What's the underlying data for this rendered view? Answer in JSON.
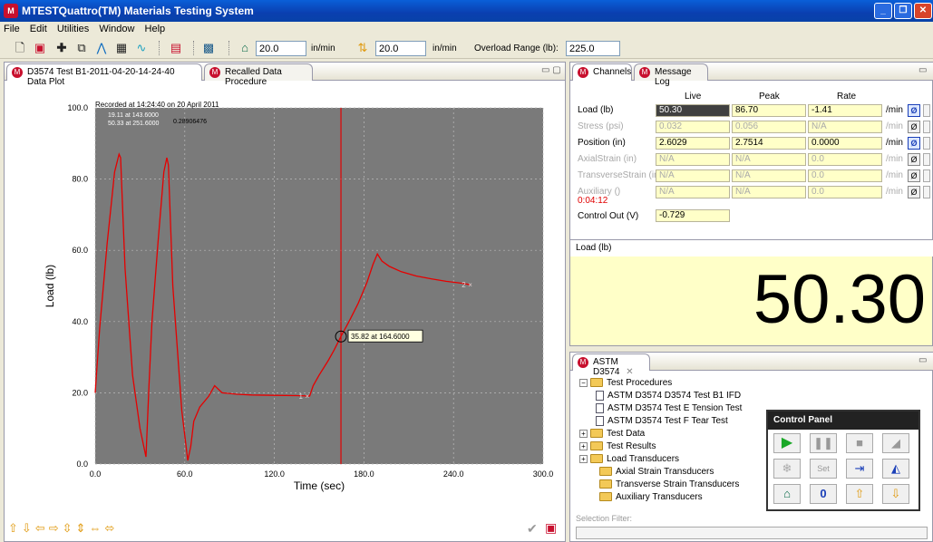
{
  "window": {
    "title": "MTESTQuattro(TM) Materials Testing System",
    "app_icon": "M"
  },
  "menu": [
    "File",
    "Edit",
    "Utilities",
    "Window",
    "Help"
  ],
  "toolbar": {
    "speed1_value": "20.0",
    "speed1_unit": "in/min",
    "speed2_value": "20.0",
    "speed2_unit": "in/min",
    "overload_label": "Overload Range (lb):",
    "overload_value": "225.0"
  },
  "left_tabs": [
    {
      "label": "D3574 Test B1-2011-04-20-14-24-40 Data Plot",
      "active": true
    },
    {
      "label": "Recalled Data Procedure",
      "active": false
    }
  ],
  "plot": {
    "recorded": "Recorded at 14:24:40 on 20 April 2011",
    "marker1": "19.11  at 143.6000",
    "marker2": "50.33  at 251.6000",
    "marker_diff": "0.28906476",
    "cursor_readout": "35.82  at 164.6000",
    "cursor_x": 164.6,
    "cursor_y": 35.82,
    "marker1_label": "1",
    "marker2_label": "2"
  },
  "chart_data": {
    "type": "line",
    "xlabel": "Time (sec)",
    "ylabel": "Load (lb)",
    "xlim": [
      0,
      300
    ],
    "ylim": [
      0,
      100
    ],
    "xticks": [
      "0.0",
      "60.0",
      "120.0",
      "180.0",
      "240.0",
      "300.0"
    ],
    "yticks": [
      "0.0",
      "20.0",
      "40.0",
      "60.0",
      "80.0",
      "100.0"
    ],
    "grid": true,
    "series": [
      {
        "color": "#e60000",
        "x": [
          0,
          3,
          8,
          13,
          16,
          17,
          20,
          25,
          30,
          34,
          36,
          38,
          42,
          46,
          48,
          49,
          52,
          58,
          62,
          64,
          66,
          70,
          76,
          80,
          85,
          95,
          105,
          120,
          135,
          143.6,
          146,
          150,
          156,
          160,
          164.6,
          170,
          176,
          182,
          186,
          189,
          192,
          197,
          205,
          215,
          225,
          235,
          245,
          251.6
        ],
        "y": [
          20,
          38,
          62,
          82,
          87,
          86,
          55,
          25,
          10,
          2,
          22,
          40,
          62,
          82,
          86,
          84,
          50,
          15,
          1,
          5,
          12,
          16,
          19,
          22,
          20,
          19.6,
          19.4,
          19.3,
          19.2,
          19.11,
          22,
          25,
          29,
          32,
          35.82,
          40,
          45,
          51,
          56,
          59,
          57,
          55.5,
          54,
          52.8,
          52,
          51.3,
          50.8,
          50.33
        ]
      }
    ]
  },
  "bottom_nav_icons": [
    "arrow-up",
    "arrow-down",
    "arrow-left",
    "arrow-right",
    "expand-vertical",
    "collapse-vertical",
    "expand-horizontal",
    "collapse-horizontal"
  ],
  "right_tabs": [
    {
      "label": "Channels",
      "active": true
    },
    {
      "label": "Message Log",
      "active": false
    }
  ],
  "channels": {
    "headers": {
      "live": "Live",
      "peak": "Peak",
      "rate": "Rate"
    },
    "rate_unit": "/min",
    "rows": [
      {
        "label": "Load (lb)",
        "live": "50.30",
        "peak": "86.70",
        "rate": "-1.41",
        "active": true,
        "selected": true
      },
      {
        "label": "Stress (psi)",
        "live": "0.032",
        "peak": "0.056",
        "rate": "N/A",
        "active": false
      },
      {
        "label": "Position (in)",
        "live": "2.6029",
        "peak": "2.7514",
        "rate": "0.0000",
        "active": true
      },
      {
        "label": "AxialStrain (in)",
        "live": "N/A",
        "peak": "N/A",
        "rate": "0.0",
        "active": false
      },
      {
        "label": "TransverseStrain (in)",
        "live": "N/A",
        "peak": "N/A",
        "rate": "0.0",
        "active": false
      },
      {
        "label": "Auxiliary ()",
        "live": "N/A",
        "peak": "N/A",
        "rate": "0.0",
        "active": false
      }
    ],
    "elapsed": "0:04:12",
    "control_out_label": "Control Out (V)",
    "control_out_value": "-0.729",
    "elapsed_color": "#e00000"
  },
  "big_display": {
    "label": "Load (lb)",
    "value": "50.30",
    "background": "#ffffc8"
  },
  "procedure": {
    "tab_label": "ASTM D3574",
    "tree": [
      {
        "label": "Test Procedures",
        "type": "folder",
        "expanded": true,
        "level": 0
      },
      {
        "label": "ASTM D3574 D3574 Test B1 IFD",
        "type": "doc",
        "level": 1
      },
      {
        "label": "ASTM D3574 Test E Tension Test",
        "type": "doc",
        "level": 1
      },
      {
        "label": "ASTM D3574 Test F Tear Test",
        "type": "doc",
        "level": 1
      },
      {
        "label": "Test Data",
        "type": "folder",
        "expanded": false,
        "level": 0
      },
      {
        "label": "Test Results",
        "type": "folder",
        "expanded": false,
        "level": 0
      },
      {
        "label": "Load Transducers",
        "type": "folder",
        "expanded": false,
        "level": 0
      },
      {
        "label": "Axial Strain Transducers",
        "type": "folder",
        "level": 1
      },
      {
        "label": "Transverse Strain Transducers",
        "type": "folder",
        "level": 1
      },
      {
        "label": "Auxiliary Transducers",
        "type": "folder",
        "level": 1
      }
    ],
    "filter_label": "Selection Filter:"
  },
  "control_panel": {
    "title": "Control Panel",
    "set_label": "Set",
    "zero_label": "0"
  }
}
